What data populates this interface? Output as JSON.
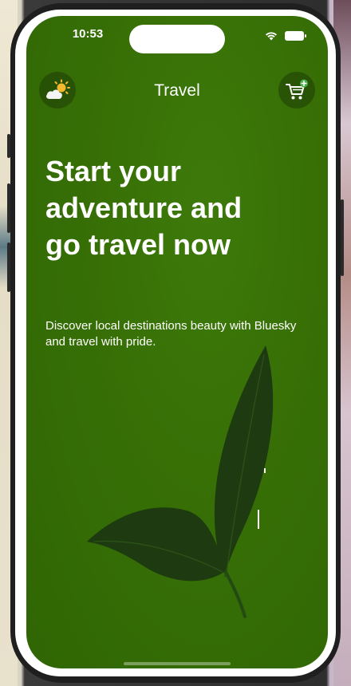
{
  "status_bar": {
    "time": "10:53"
  },
  "header": {
    "title": "Travel",
    "left_icon": "weather-icon",
    "right_icon": "cart-add-icon"
  },
  "hero": {
    "title": "Start your adventure and go travel now",
    "subtitle": "Discover local destinations beauty with Bluesky and travel with pride."
  },
  "colors": {
    "background": "#376f06",
    "text": "#ffffff",
    "leaf": "#1d3a10",
    "cart_badge": "#4caf50",
    "sun": "#f5b82e"
  }
}
